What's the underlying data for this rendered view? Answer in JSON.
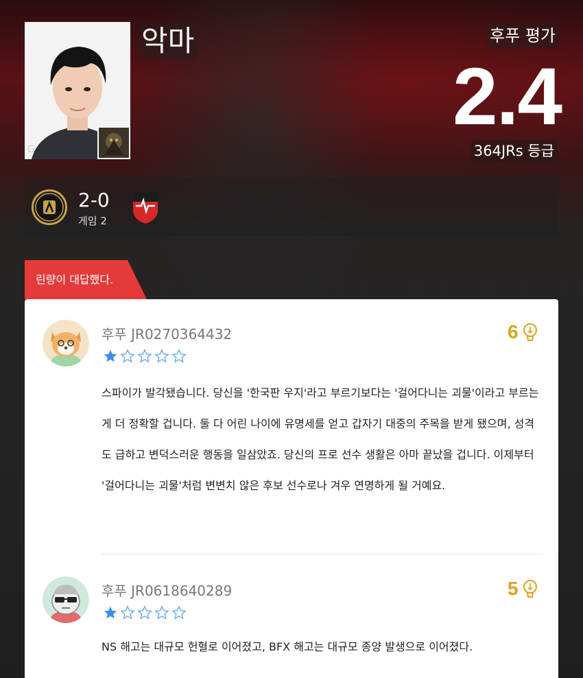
{
  "player": {
    "name": "악마",
    "photo_icon": "player-portrait",
    "champion_icon": "champion-thumbnail"
  },
  "rating": {
    "label": "후푸 평가",
    "value": "2.4",
    "count_text": "364JRs 등급"
  },
  "match": {
    "score": "2-0",
    "game": "게임 2",
    "left_team_icon": "team-logo-gold",
    "right_team_icon": "team-logo-red"
  },
  "tag": {
    "text": "린량이 대답했다."
  },
  "colors": {
    "accent_red": "#e43a3a",
    "like_gold": "#d9a520",
    "star_blue": "#3a8ee8"
  },
  "comments": [
    {
      "user": "후푸 JR0270364432",
      "rating": 1,
      "max_rating": 5,
      "likes": "6",
      "avatar_icon": "dog-avatar",
      "text": "스파이가 발각됐습니다. 당신을 '한국판 우지'라고 부르기보다는 '걸어다니는 괴물'이라고 부르는 게 더 정확할 겁니다. 둘 다 어린 나이에 유명세를 얻고 갑자기 대중의 주목을 받게 됐으며, 성격도 급하고 변덕스러운 행동을 일삼았죠. 당신의 프로 선수 생활은 아마 끝났을 겁니다. 이제부터 '걸어다니는 괴물'처럼 변변치 않은 후보 선수로나 겨우 연명하게 될 거예요."
    },
    {
      "user": "후푸 JR0618640289",
      "rating": 1,
      "max_rating": 5,
      "likes": "5",
      "avatar_icon": "sunglasses-avatar",
      "text": "NS 해고는 대규모 헌혈로 이어졌고, BFX 해고는 대규모 종양 발생으로 이어졌다."
    }
  ]
}
